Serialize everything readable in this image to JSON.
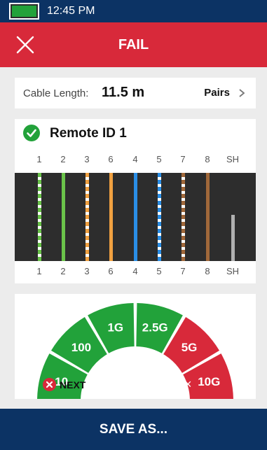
{
  "status_bar": {
    "time": "12:45 PM",
    "battery_level": 1.0
  },
  "header": {
    "title": "FAIL",
    "close_icon": "close-icon"
  },
  "cable": {
    "label": "Cable Length:",
    "value": "11.5 m",
    "pairs_label": "Pairs"
  },
  "remote": {
    "title": "Remote ID 1",
    "status_icon": "check-circle-icon"
  },
  "wiremap": {
    "pins": [
      "1",
      "2",
      "3",
      "6",
      "4",
      "5",
      "7",
      "8",
      "SH"
    ],
    "wires": [
      {
        "pin": "1",
        "color": "#6ac34a",
        "striped": true
      },
      {
        "pin": "2",
        "color": "#6ac34a",
        "striped": false
      },
      {
        "pin": "3",
        "color": "#f0a040",
        "striped": true
      },
      {
        "pin": "6",
        "color": "#f0a040",
        "striped": false
      },
      {
        "pin": "4",
        "color": "#2a8ee6",
        "striped": false
      },
      {
        "pin": "5",
        "color": "#2a8ee6",
        "striped": true
      },
      {
        "pin": "7",
        "color": "#a0683a",
        "striped": true
      },
      {
        "pin": "8",
        "color": "#a0683a",
        "striped": false
      }
    ],
    "shield_level": 0.52
  },
  "speeds": [
    {
      "label": "10",
      "status": "pass"
    },
    {
      "label": "100",
      "status": "pass"
    },
    {
      "label": "1G",
      "status": "pass"
    },
    {
      "label": "2.5G",
      "status": "pass"
    },
    {
      "label": "5G",
      "status": "fail"
    },
    {
      "label": "10G",
      "status": "fail",
      "marker": "×"
    }
  ],
  "next": {
    "label": "NEXT",
    "status": "fail"
  },
  "footer": {
    "save_label": "SAVE AS..."
  },
  "colors": {
    "navy": "#0c3364",
    "red": "#d8293a",
    "pass_green": "#22a23a",
    "fail_red": "#d8293a"
  }
}
